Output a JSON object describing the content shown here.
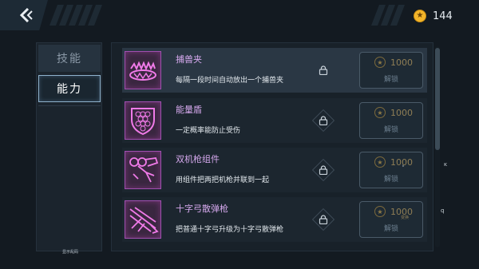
{
  "topbar": {
    "back_icon": "chevron-left-icon",
    "currency_icon": "star-coin-icon",
    "currency_amount": "144"
  },
  "sidebar": {
    "tabs": [
      {
        "label": "技能"
      },
      {
        "label": "能力"
      }
    ],
    "selected": "能力",
    "note": "显示乱码"
  },
  "items": [
    {
      "name": "捕兽夹",
      "desc": "每隔一段时间自动放出一个捕兽夹",
      "icon": "bear-trap-icon",
      "price": "1000",
      "unlock_label": "解锁",
      "price_suffix": "",
      "extra_mark": ""
    },
    {
      "name": "能量盾",
      "desc": "一定概率能防止受伤",
      "icon": "energy-shield-icon",
      "price": "1000",
      "unlock_label": "解锁",
      "price_suffix": "",
      "extra_mark": ""
    },
    {
      "name": "双机枪组件",
      "desc": "用组件把两把机枪并联到一起",
      "icon": "twin-gun-icon",
      "price": "1000",
      "unlock_label": "解锁",
      "price_suffix": "",
      "extra_mark": "ᵏ"
    },
    {
      "name": "十字弓散弹枪",
      "desc": "把普通十字弓升级为十字弓散弹枪",
      "icon": "crossbow-shotgun-icon",
      "price": "1000",
      "unlock_label": "解锁",
      "price_suffix": "变换",
      "extra_mark": ""
    }
  ],
  "side_glyphs": {
    "g1": "ĸ",
    "g2": "q"
  },
  "colors": {
    "accent_pink": "#d6a9ee",
    "coin_gold": "#f3b52a",
    "background": "#131a21"
  }
}
